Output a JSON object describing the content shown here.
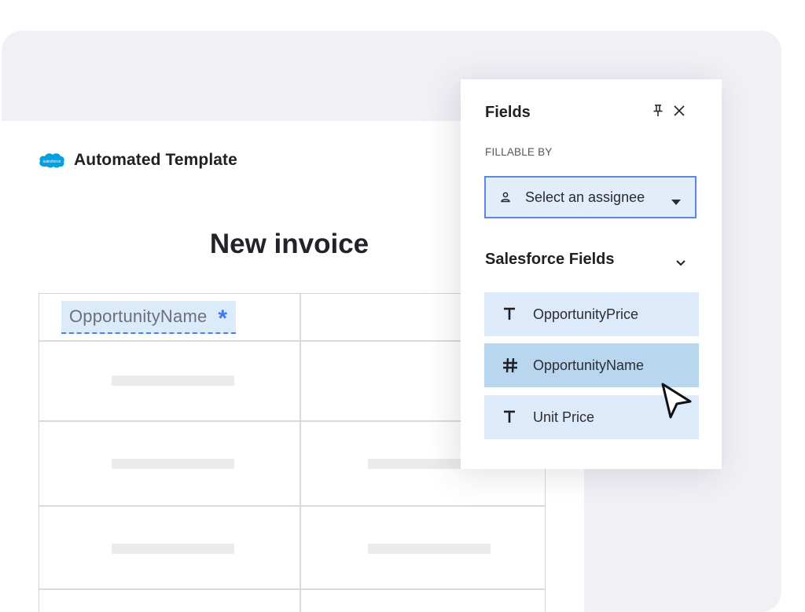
{
  "document": {
    "header_title": "Automated Template",
    "brand_logo": "salesforce-logo",
    "invoice_title": "New invoice",
    "field_chip": {
      "label": "OpportunityName",
      "required_marker": "*"
    }
  },
  "fields_panel": {
    "title": "Fields",
    "pin_icon": "pin-icon",
    "close_icon": "close-icon",
    "fillable_by_label": "FILLABLE BY",
    "assignee_select": {
      "value": "Select an assignee",
      "icon": "person-icon"
    },
    "salesforce_section": {
      "heading": "Salesforce Fields",
      "expanded": true,
      "items": [
        {
          "label": "OpportunityPrice",
          "type_icon": "text-type-icon",
          "active": false
        },
        {
          "label": "OpportunityName",
          "type_icon": "number-type-icon",
          "active": true
        },
        {
          "label": "Unit Price",
          "type_icon": "text-type-icon",
          "active": false
        }
      ]
    }
  },
  "colors": {
    "accent_blue": "#3f78f0",
    "field_item_bg": "#dceafa",
    "field_item_active_bg": "#b8d6ee",
    "backdrop": "#f1f0f5",
    "salesforce_blue": "#00a1e0"
  }
}
